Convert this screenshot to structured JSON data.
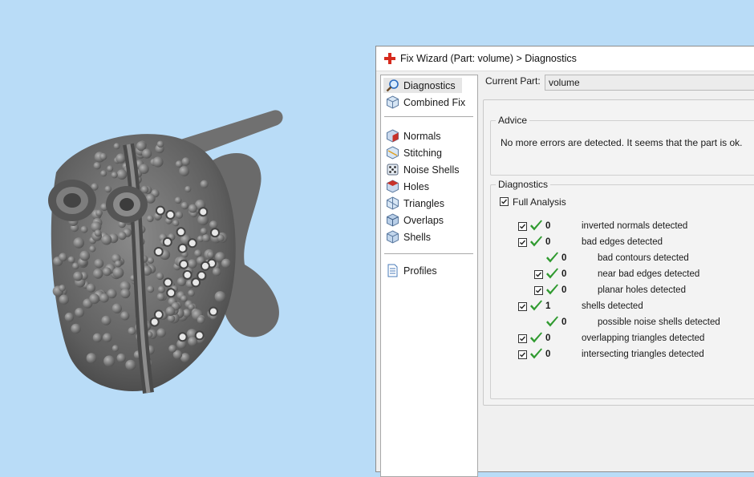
{
  "window": {
    "title": "Fix Wizard (Part: volume) > Diagnostics"
  },
  "sidebar": {
    "items": [
      {
        "label": "Diagnostics",
        "icon": "magnifier-icon"
      },
      {
        "label": "Combined Fix",
        "icon": "cube-icon"
      },
      {
        "label": "Normals",
        "icon": "normals-cube-icon"
      },
      {
        "label": "Stitching",
        "icon": "stitching-cube-icon"
      },
      {
        "label": "Noise Shells",
        "icon": "noise-dice-icon"
      },
      {
        "label": "Holes",
        "icon": "holes-cube-icon"
      },
      {
        "label": "Triangles",
        "icon": "triangles-cube-icon"
      },
      {
        "label": "Overlaps",
        "icon": "overlaps-cube-icon"
      },
      {
        "label": "Shells",
        "icon": "shells-cube-icon"
      },
      {
        "label": "Profiles",
        "icon": "document-icon"
      }
    ]
  },
  "current_part": {
    "label": "Current Part:",
    "value": "volume"
  },
  "advice": {
    "title": "Advice",
    "text": "No more errors are detected. It seems that the part is ok."
  },
  "diagnostics": {
    "title": "Diagnostics",
    "full_analysis": "Full Analysis",
    "rows": [
      {
        "count": "0",
        "label": "inverted normals detected"
      },
      {
        "count": "0",
        "label": "bad edges detected"
      },
      {
        "count": "0",
        "label": "bad contours detected"
      },
      {
        "count": "0",
        "label": "near bad edges detected"
      },
      {
        "count": "0",
        "label": "planar holes detected"
      },
      {
        "count": "1",
        "label": "shells detected"
      },
      {
        "count": "0",
        "label": "possible noise shells detected"
      },
      {
        "count": "0",
        "label": "overlapping triangles detected"
      },
      {
        "count": "0",
        "label": "intersecting triangles detected"
      }
    ]
  },
  "colors": {
    "viewport_background": "#b9dcf7",
    "check_green": "#2f9a2f",
    "model_gray": "#6b6b6b"
  }
}
